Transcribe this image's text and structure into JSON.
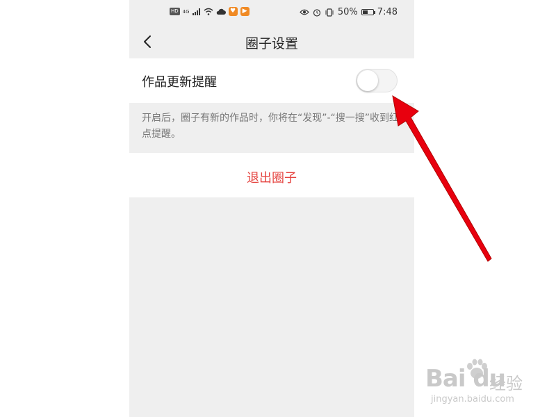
{
  "status_bar": {
    "hd": "HD",
    "signal_label": "4G",
    "battery_percent_text": "50%",
    "battery_level": 0.5,
    "time": "7:48"
  },
  "nav": {
    "title": "圈子设置"
  },
  "settings": {
    "work_update_reminder": {
      "label": "作品更新提醒",
      "enabled": false
    },
    "description": "开启后，圈子有新的作品时，你将在“发现”-“搜一搜”收到红点提醒。"
  },
  "actions": {
    "exit_label": "退出圈子"
  },
  "colors": {
    "exit_text": "#e5433f",
    "arrow": "#e8000e",
    "background": "#efefef"
  },
  "watermark": {
    "brand": "Bai du",
    "cn": "经验",
    "url": "jingyan.baidu.com"
  }
}
